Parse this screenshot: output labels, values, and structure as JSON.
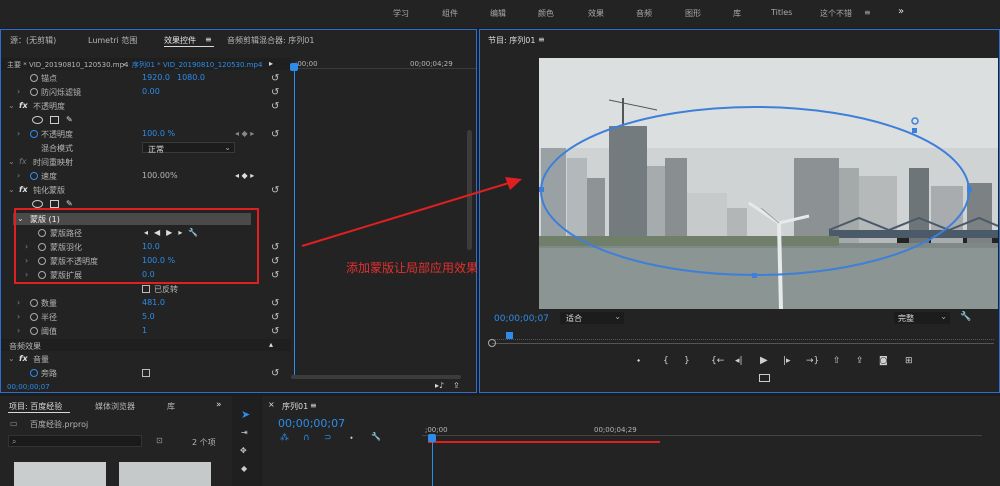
{
  "topbar": {
    "menu": [
      "学习",
      "组件",
      "编辑",
      "颜色",
      "效果",
      "音频",
      "图形",
      "库",
      "Titles",
      "这个不错"
    ],
    "active_menu": "这个不错",
    "overflow": "»"
  },
  "effect_panel": {
    "tabs": [
      "源：(无剪辑)",
      "Lumetri 范围",
      "效果控件",
      "音频剪辑混合器: 序列01"
    ],
    "tab_menu": "≡",
    "clip_left": "主要 * VID_20190810_120530.mp4",
    "clip_right": "序列01 * VID_20190810_120530.mp4",
    "ruler_start": ";00;00",
    "ruler_end": "00;00;04;29",
    "rows": {
      "anchor": {
        "label": "锚点",
        "value_x": "1920.0",
        "value_y": "1080.0"
      },
      "flicker": {
        "label": "防闪烁滤镜",
        "value": "0.00"
      },
      "opacity_group": {
        "label": "不透明度"
      },
      "opacity": {
        "label": "不透明度",
        "value": "100.0 %"
      },
      "blend": {
        "label": "混合模式",
        "value": "正常"
      },
      "time_remap": {
        "label": "时间重映射"
      },
      "speed": {
        "label": "速度",
        "value": "100.00%"
      },
      "blur_group": {
        "label": "钝化蒙版"
      },
      "mask": {
        "label": "蒙版 (1)"
      },
      "mask_path": {
        "label": "蒙版路径"
      },
      "mask_feather": {
        "label": "蒙版羽化",
        "value": "10.0"
      },
      "mask_opacity": {
        "label": "蒙版不透明度",
        "value": "100.0 %"
      },
      "mask_expansion": {
        "label": "蒙版扩展",
        "value": "0.0"
      },
      "inverted": {
        "label": "已反转"
      },
      "amount": {
        "label": "数量",
        "value": "481.0"
      },
      "radius": {
        "label": "半径",
        "value": "5.0"
      },
      "threshold": {
        "label": "阈值",
        "value": "1"
      },
      "audio_effects": {
        "label": "音频效果"
      },
      "volume": {
        "label": "音量"
      },
      "bypass": {
        "label": "旁路"
      }
    },
    "timecode": "00;00;00;07"
  },
  "monitor": {
    "title": "节目: 序列01",
    "menu": "≡",
    "timecode": "00;00;00;07",
    "fit": "适合",
    "quality": "完整",
    "annotation": "添加蒙版让局部应用效果"
  },
  "project": {
    "tabs": [
      "项目: 百度经验",
      "媒体浏览器",
      "库"
    ],
    "overflow": "»",
    "file": "百度经验.prproj",
    "item_count": "2 个项"
  },
  "timeline": {
    "tab": "序列01",
    "menu": "≡",
    "timecode": "00;00;00;07",
    "ruler_start": ";00;00",
    "ruler_mid": "00;00;04;29"
  },
  "colors": {
    "accent_blue": "#2d8ceb",
    "highlight_red": "#e02020",
    "panel_bg": "#232323"
  }
}
